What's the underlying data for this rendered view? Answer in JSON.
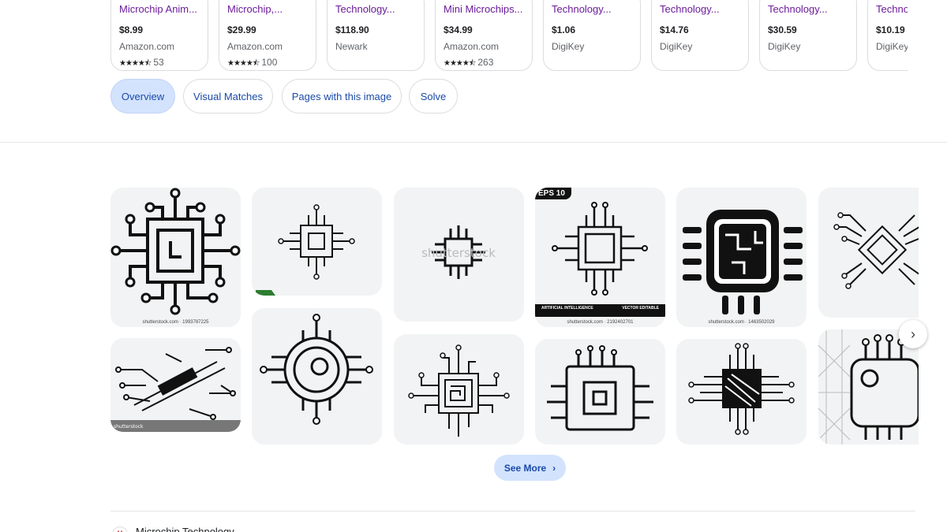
{
  "products": [
    {
      "title": "Microchip Anim...",
      "price": "$8.99",
      "seller": "Amazon.com",
      "stars": "★★★★⯪",
      "reviews": "53"
    },
    {
      "title": "Microchip,...",
      "price": "$29.99",
      "seller": "Amazon.com",
      "stars": "★★★★⯪",
      "reviews": "100"
    },
    {
      "title": "Technology...",
      "price": "$118.90",
      "seller": "Newark",
      "stars": "",
      "reviews": ""
    },
    {
      "title": "Mini Microchips...",
      "price": "$34.99",
      "seller": "Amazon.com",
      "stars": "★★★★⯪",
      "reviews": "263"
    },
    {
      "title": "Technology...",
      "price": "$1.06",
      "seller": "DigiKey",
      "stars": "",
      "reviews": ""
    },
    {
      "title": "Technology...",
      "price": "$14.76",
      "seller": "DigiKey",
      "stars": "",
      "reviews": ""
    },
    {
      "title": "Technology...",
      "price": "$30.59",
      "seller": "DigiKey",
      "stars": "",
      "reviews": ""
    },
    {
      "title": "Technology...",
      "price": "$10.19",
      "seller": "DigiKey",
      "stars": "",
      "reviews": ""
    }
  ],
  "chips": [
    {
      "label": "Overview",
      "active": true
    },
    {
      "label": "Visual Matches",
      "active": false
    },
    {
      "label": "Pages with this image",
      "active": false
    },
    {
      "label": "Solve",
      "active": false
    }
  ],
  "tiles": {
    "t1": {
      "watermark": "shutterstock.com · 1993787225"
    },
    "t4": {
      "badge": "EPS 10",
      "banner_left": "ARTIFICIAL INTELLIGENCE",
      "banner_right": "VECTOR EDITABLE",
      "watermark": "shutterstock.com · 2192402701"
    },
    "t5": {
      "watermark": "shutterstock.com · 1463502029"
    },
    "t7": {
      "watermark": "shutterstock"
    }
  },
  "see_more": {
    "label": "See More"
  },
  "source": {
    "name": "Microchip Technology"
  },
  "colors": {
    "accent_chip": "#d3e3fd",
    "link_blue": "#1a4aa8",
    "product_title": "#6a1b9a"
  }
}
